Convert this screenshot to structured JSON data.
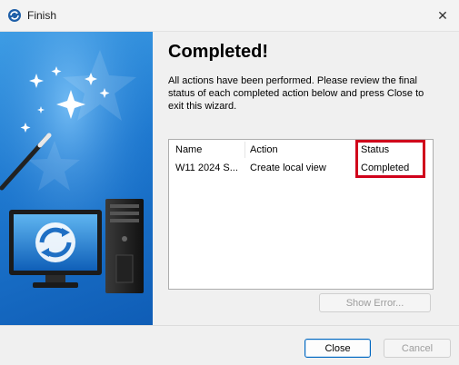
{
  "window": {
    "title": "Finish",
    "close_glyph": "✕",
    "icon": "wizard-refresh-icon"
  },
  "main": {
    "heading": "Completed!",
    "description": "All actions have been performed. Please review the final status of each completed action below and press Close to exit this wizard."
  },
  "results": {
    "columns": [
      "Name",
      "Action",
      "Status"
    ],
    "rows": [
      {
        "name": "W11 2024 S...",
        "action": "Create local view",
        "status": "Completed"
      }
    ],
    "highlight_color": "#d0021b"
  },
  "buttons": {
    "show_error": "Show Error...",
    "close": "Close",
    "cancel": "Cancel"
  },
  "banner": {
    "graphic": "wizard-wand-computer-illustration"
  }
}
